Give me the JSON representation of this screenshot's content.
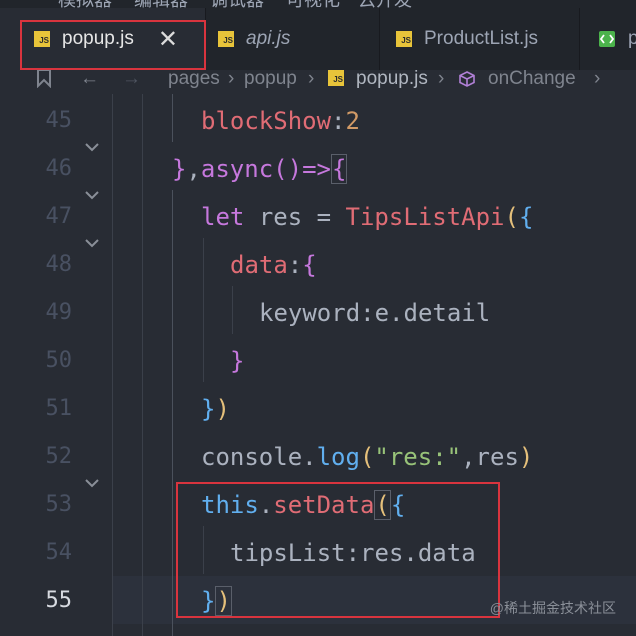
{
  "menubar": {
    "items": [
      "模拟器",
      "编辑器",
      "调试器",
      "可视化",
      "云开发"
    ]
  },
  "tabs": [
    {
      "label": "popup.js",
      "active": true,
      "close": "✕",
      "icon": "js-file-icon"
    },
    {
      "label": "api.js",
      "active": false,
      "italic": true,
      "icon": "js-file-icon"
    },
    {
      "label": "ProductList.js",
      "active": false,
      "icon": "js-file-icon"
    },
    {
      "label": "p",
      "active": false,
      "icon": "wxml-file-icon"
    }
  ],
  "breadcrumb": {
    "items": [
      "pages",
      "popup",
      "popup.js",
      "onChange"
    ]
  },
  "editor": {
    "current_line": "55",
    "lines": [
      {
        "num": "45"
      },
      {
        "num": "46"
      },
      {
        "num": "47"
      },
      {
        "num": "48"
      },
      {
        "num": "49"
      },
      {
        "num": "50"
      },
      {
        "num": "51"
      },
      {
        "num": "52"
      },
      {
        "num": "53"
      },
      {
        "num": "54"
      },
      {
        "num": "55"
      }
    ]
  },
  "watermark": "@稀土掘金技术社区",
  "colors": {
    "keyword": "#c678dd",
    "function": "#61afef",
    "string": "#98c379",
    "number": "#d19a66",
    "property": "#e06c75",
    "highlight": "#d9343e"
  }
}
